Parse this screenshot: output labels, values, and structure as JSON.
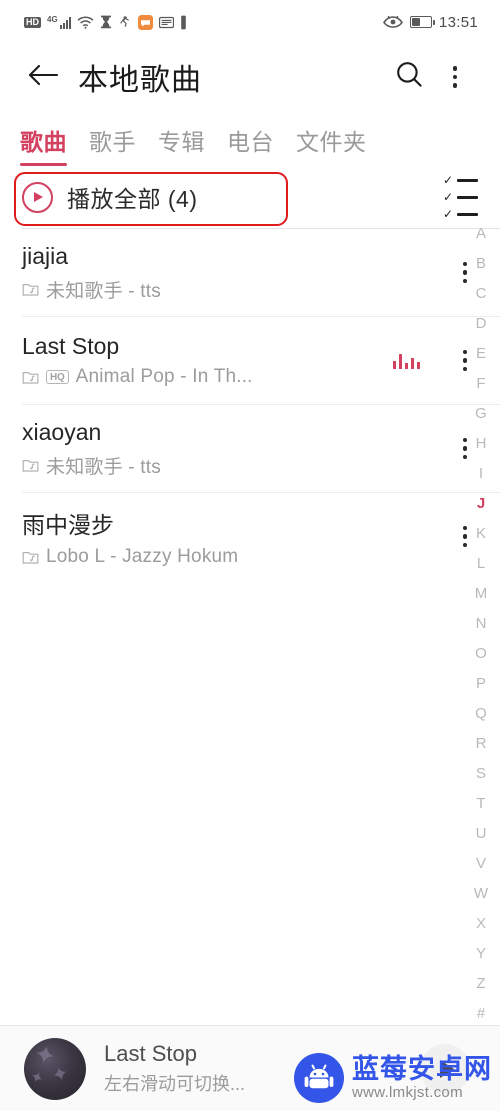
{
  "statusbar": {
    "hd_label": "HD",
    "network_gen": "4G",
    "icons": [
      "hd-badge",
      "signal-bars-icon",
      "wifi-icon",
      "hourglass-icon",
      "do-not-disturb-icon",
      "message-icon",
      "inbox-icon",
      "vibrate-icon"
    ],
    "right_icons": [
      "eye-care-icon",
      "battery-icon"
    ],
    "time": "13:51"
  },
  "appbar": {
    "back_icon": "arrow-left-icon",
    "title": "本地歌曲",
    "search_icon": "search-icon",
    "overflow_icon": "more-vertical-icon"
  },
  "tabs": [
    {
      "label": "歌曲",
      "active": true
    },
    {
      "label": "歌手",
      "active": false
    },
    {
      "label": "专辑",
      "active": false
    },
    {
      "label": "电台",
      "active": false
    },
    {
      "label": "文件夹",
      "active": false
    }
  ],
  "playall": {
    "label": "播放全部 (4)",
    "play_icon": "play-circle-icon",
    "multiselect_icon": "checklist-icon",
    "annotation_color": "#e01b1b"
  },
  "songs": [
    {
      "title": "jiajia",
      "meta": "未知歌手 - tts",
      "file_icon": "music-file-icon",
      "hq": false,
      "hq_label": "HQ",
      "playing": false,
      "menu_icon": "more-vertical-icon"
    },
    {
      "title": "Last Stop",
      "meta": "Animal Pop - In Th...",
      "file_icon": "music-file-icon",
      "hq": true,
      "hq_label": "HQ",
      "playing": true,
      "menu_icon": "more-vertical-icon"
    },
    {
      "title": "xiaoyan",
      "meta": "未知歌手 - tts",
      "file_icon": "music-file-icon",
      "hq": false,
      "hq_label": "HQ",
      "playing": false,
      "menu_icon": "more-vertical-icon"
    },
    {
      "title": "雨中漫步",
      "meta": "Lobo L - Jazzy Hokum",
      "file_icon": "music-file-icon",
      "hq": false,
      "hq_label": "HQ",
      "playing": false,
      "menu_icon": "more-vertical-icon"
    }
  ],
  "index": {
    "letters": [
      "A",
      "B",
      "C",
      "D",
      "E",
      "F",
      "G",
      "H",
      "I",
      "J",
      "K",
      "L",
      "M",
      "N",
      "O",
      "P",
      "Q",
      "R",
      "S",
      "T",
      "U",
      "V",
      "W",
      "X",
      "Y",
      "Z",
      "#"
    ],
    "active": "J"
  },
  "mini_player": {
    "title": "Last Stop",
    "subtitle": "左右滑动可切换...",
    "cover_icon": "album-art",
    "play_icon": "play-icon"
  },
  "watermark": {
    "site_name": "蓝莓安卓网",
    "url": "www.lmkjst.com",
    "logo_icon": "android-robot-icon",
    "color": "#3355e8"
  },
  "theme": {
    "accent": "#d4405f",
    "annotation": "#e01b1b",
    "text_primary": "#262626",
    "text_secondary": "#9c9c9c"
  }
}
